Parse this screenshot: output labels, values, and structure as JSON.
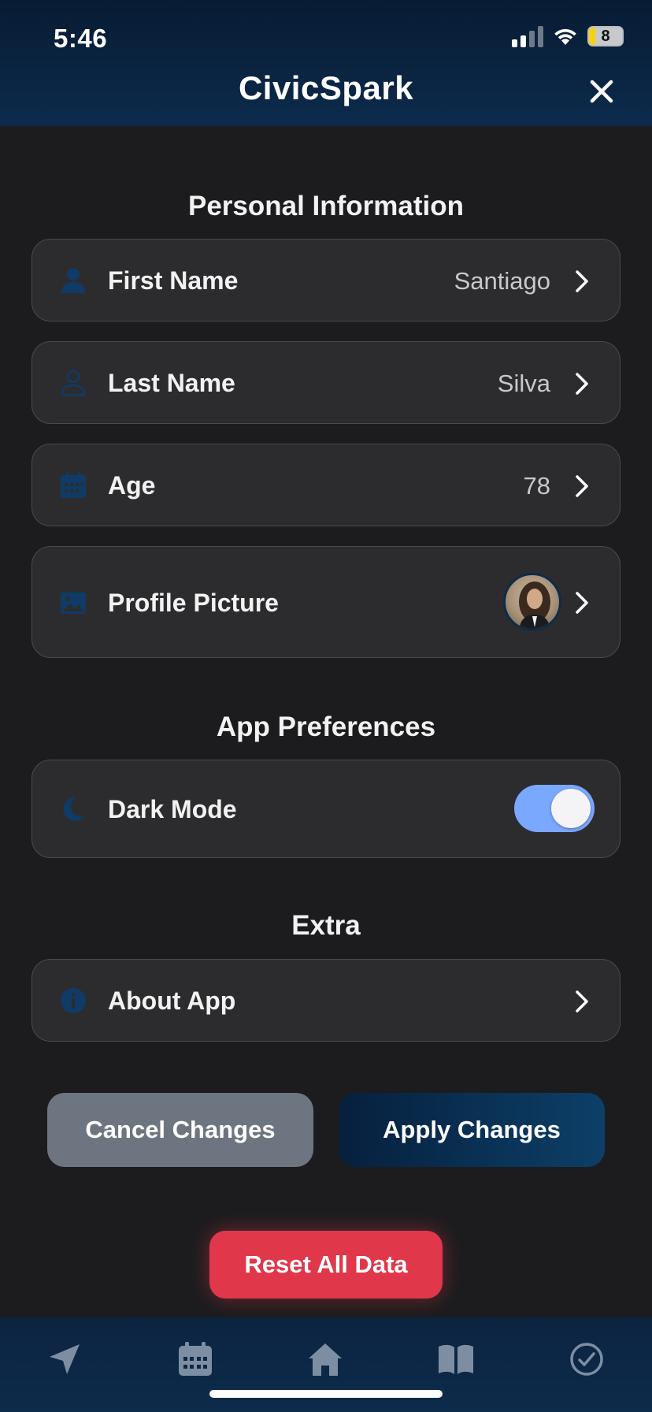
{
  "status_bar": {
    "time": "5:46",
    "battery": "8"
  },
  "header": {
    "title": "CivicSpark"
  },
  "sections": {
    "personal": "Personal Information",
    "prefs": "App Preferences",
    "extra": "Extra"
  },
  "personal_rows": {
    "first_name": {
      "label": "First Name",
      "value": "Santiago"
    },
    "last_name": {
      "label": "Last Name",
      "value": "Silva"
    },
    "age": {
      "label": "Age",
      "value": "78"
    },
    "profile_picture": {
      "label": "Profile Picture"
    }
  },
  "preferences": {
    "dark_mode": {
      "label": "Dark Mode",
      "enabled": true
    }
  },
  "extra_rows": {
    "about": {
      "label": "About App"
    }
  },
  "buttons": {
    "cancel": "Cancel Changes",
    "apply": "Apply Changes",
    "reset": "Reset All Data"
  },
  "tabbar": {
    "items": [
      "navigation-arrow-icon",
      "calendar-icon",
      "home-icon",
      "book-icon",
      "checkmark-circle-icon"
    ]
  },
  "colors": {
    "accent_navy": "#0d2b4a",
    "row_icon": "#0f3b66",
    "toggle_on": "#7aa7ff",
    "danger": "#e0374a",
    "cancel_gray": "#6d7580"
  }
}
